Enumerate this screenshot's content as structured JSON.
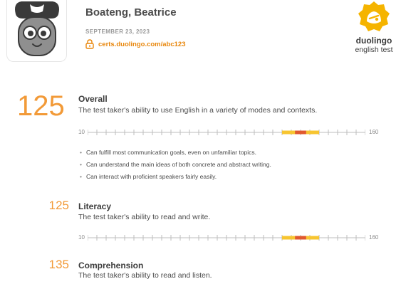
{
  "candidate": {
    "name": "Boateng, Beatrice",
    "date": "SEPTEMBER 23, 2023",
    "cert_url": "certs.duolingo.com/abc123"
  },
  "brand": {
    "word": "duolingo",
    "sub": "english test",
    "color": "#f5b400",
    "icon": "duolingo-owl-badge-icon"
  },
  "accent_color": "#f29a38",
  "scale": {
    "min": 10,
    "max": 160,
    "min_label": "10",
    "max_label": "160"
  },
  "sections": {
    "overall": {
      "score": 125,
      "score_label": "125",
      "title": "Overall",
      "desc": "The test taker's ability to use English in a variety of modes and contexts.",
      "bullets": [
        "Can fulfill most communication goals, even on unfamiliar topics.",
        "Can understand the main ideas of both concrete and abstract writing.",
        "Can interact with proficient speakers fairly easily."
      ]
    },
    "literacy": {
      "score": 125,
      "score_label": "125",
      "title": "Literacy",
      "desc": "The test taker's ability to read and write."
    },
    "comprehension": {
      "score": 135,
      "score_label": "135",
      "title": "Comprehension",
      "desc": "The test taker's ability to read and listen."
    }
  }
}
